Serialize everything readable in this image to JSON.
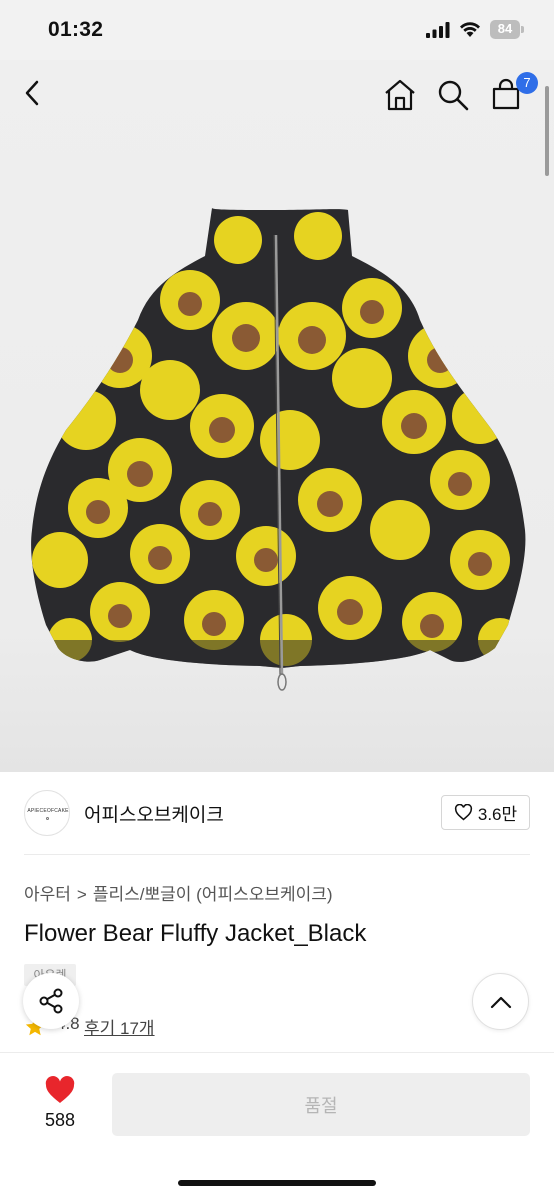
{
  "status_bar": {
    "time": "01:32",
    "battery": "84"
  },
  "nav": {
    "cart_count": "7"
  },
  "product": {
    "brand_logo_text": "APIECEOFCAKE",
    "brand_name": "어피스오브케이크",
    "brand_likes": "3.6만",
    "category_parent": "아우터",
    "category_separator": ">",
    "category_child": "플리스/뽀글이 (어피스오브케이크)",
    "title": "Flower Bear Fluffy Jacket_Black",
    "tag": "아우렛",
    "rating": "4.8",
    "review_link": "후기 17개"
  },
  "bottom_bar": {
    "like_total": "588",
    "purchase_label": "품절"
  },
  "colors": {
    "accent_badge": "#2f6ee8",
    "heart": "#e8262c",
    "star": "#f5b800"
  }
}
